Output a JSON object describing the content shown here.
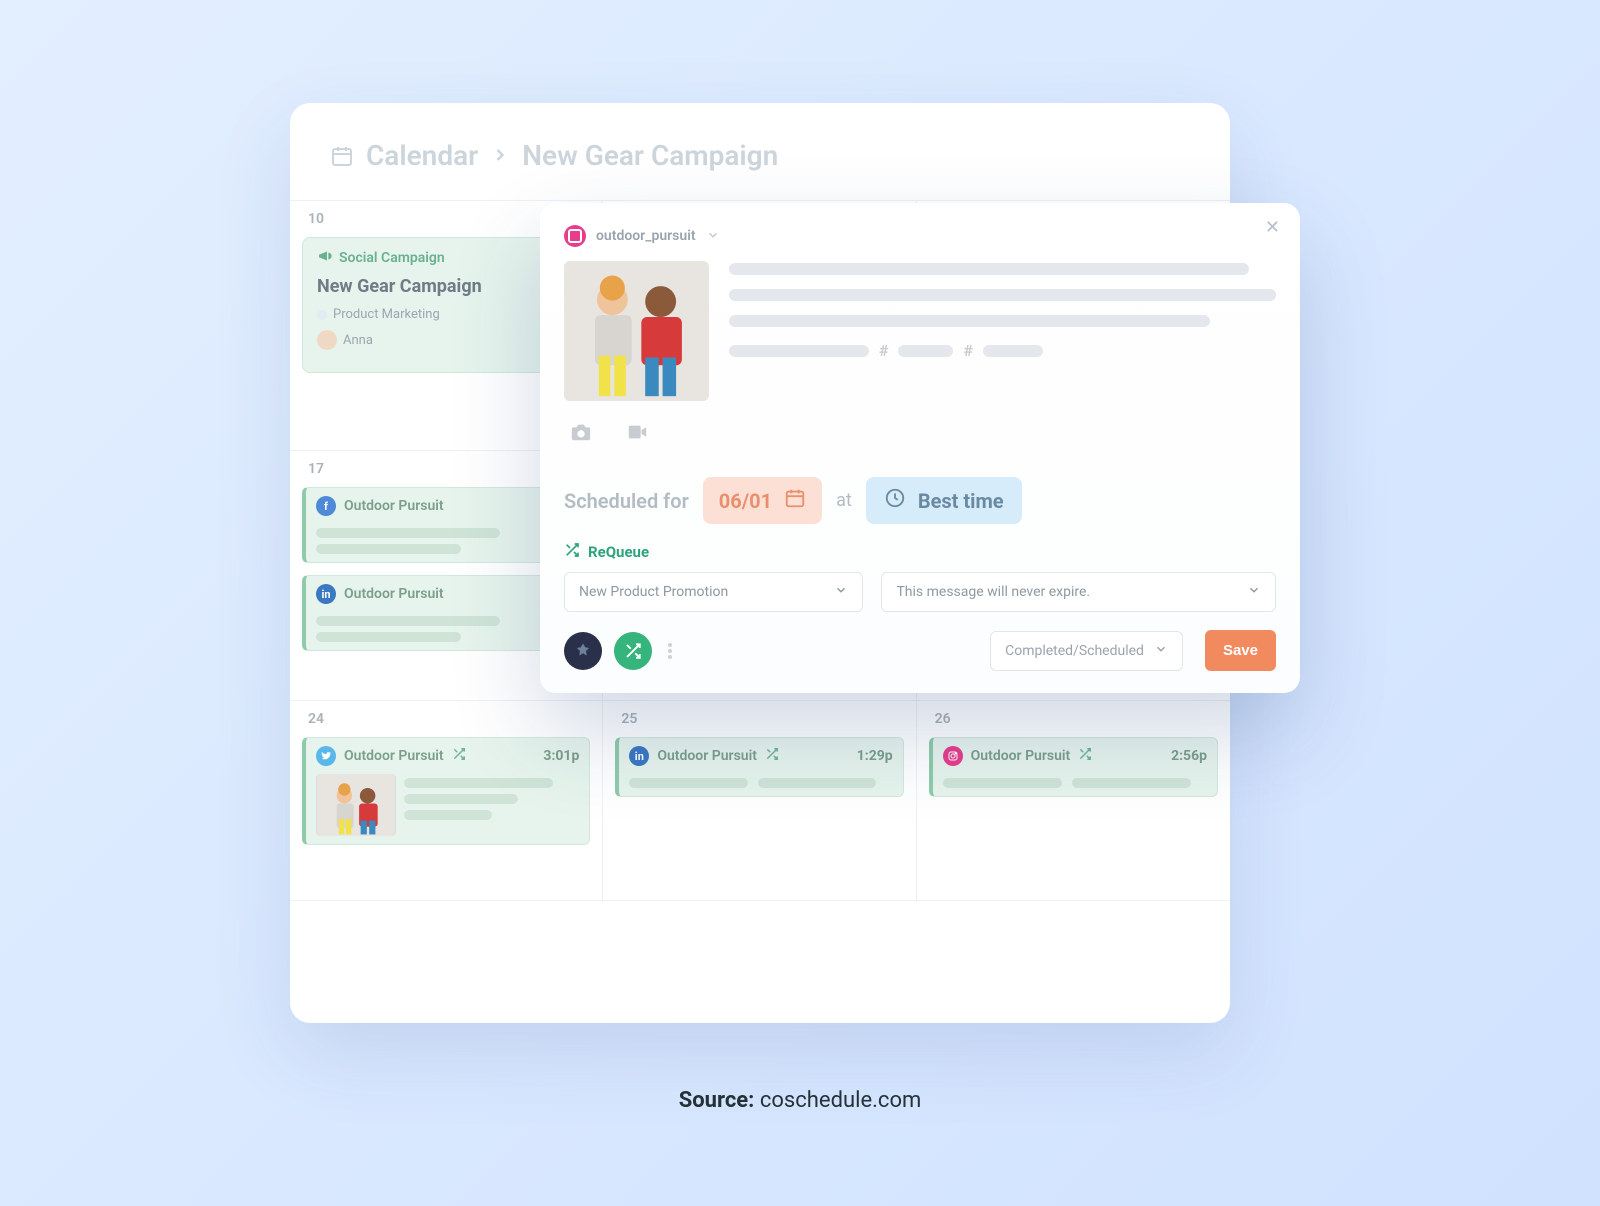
{
  "breadcrumb": {
    "root": "Calendar",
    "page": "New Gear Campaign"
  },
  "calendar": {
    "cells": [
      {
        "date": "10"
      },
      {
        "date": ""
      },
      {
        "date": ""
      },
      {
        "date": "17"
      },
      {
        "date": ""
      },
      {
        "date": ""
      },
      {
        "date": "24"
      },
      {
        "date": "25"
      },
      {
        "date": "26"
      }
    ],
    "campaign_card": {
      "tag": "Social Campaign",
      "title": "New Gear Campaign",
      "dept": "Product Marketing",
      "owner": "Anna"
    },
    "events_row2": [
      {
        "network": "fb",
        "title": "Outdoor Pursuit"
      },
      {
        "network": "li",
        "title": "Outdoor Pursuit"
      }
    ],
    "events_row3": [
      {
        "network": "tw",
        "title": "Outdoor Pursuit",
        "time": "3:01p",
        "has_thumb": true
      },
      {
        "network": "li",
        "title": "Outdoor Pursuit",
        "time": "1:29p",
        "has_thumb": false
      },
      {
        "network": "ig",
        "title": "Outdoor Pursuit",
        "time": "2:56p",
        "has_thumb": false
      }
    ]
  },
  "composer": {
    "account": "outdoor_pursuit",
    "scheduled_label": "Scheduled for",
    "date": "06/01",
    "at": "at",
    "time_mode": "Best time",
    "requeue_label": "ReQueue",
    "group_select": "New Product Promotion",
    "expire_select": "This message will never expire.",
    "status": "Completed/Scheduled",
    "save": "Save"
  },
  "source": {
    "label": "Source:",
    "value": "coschedule.com"
  }
}
